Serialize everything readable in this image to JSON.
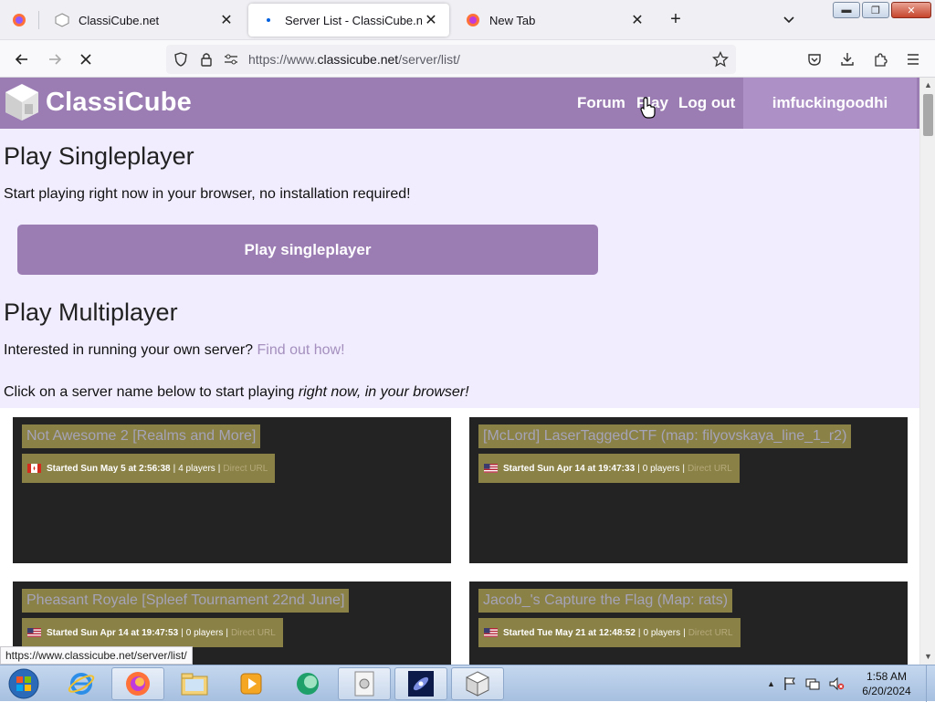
{
  "browser": {
    "tabs": [
      {
        "label": "ClassiCube.net",
        "active": false
      },
      {
        "label": "Server List - ClassiCube.net",
        "active": true
      },
      {
        "label": "New Tab",
        "active": false
      }
    ],
    "url_prefix": "https://www.",
    "url_domain": "classicube.net",
    "url_path": "/server/list/",
    "status_url": "https://www.classicube.net/server/list/"
  },
  "site": {
    "logo": "ClassiCube",
    "nav": {
      "forum": "Forum",
      "play": "Play",
      "logout": "Log out"
    },
    "username": "imfuckingoodhi"
  },
  "singleplayer": {
    "heading": "Play Singleplayer",
    "description": "Start playing right now in your browser, no installation required!",
    "button": "Play singleplayer"
  },
  "multiplayer": {
    "heading": "Play Multiplayer",
    "own_server_text": "Interested in running your own server?",
    "own_server_link": "Find out how!",
    "instruction_prefix": "Click on a server name below to start playing ",
    "instruction_emphasis": "right now, in your browser!"
  },
  "servers": [
    {
      "name": "Not Awesome 2 [Realms and More]",
      "flag": "ca",
      "started": "Started Sun May 5 at 2:56:38",
      "players": "4 players",
      "direct": "Direct URL"
    },
    {
      "name": "[McLord] LaserTaggedCTF (map: filyovskaya_line_1_r2)",
      "flag": "us",
      "started": "Started Sun Apr 14 at 19:47:33",
      "players": "0 players",
      "direct": "Direct URL"
    },
    {
      "name": "Pheasant Royale [Spleef Tournament 22nd June]",
      "flag": "us",
      "started": "Started Sun Apr 14 at 19:47:53",
      "players": "0 players",
      "direct": "Direct URL"
    },
    {
      "name": "Jacob_'s Capture the Flag (Map: rats)",
      "flag": "us",
      "started": "Started Tue May 21 at 12:48:52",
      "players": "0 players",
      "direct": "Direct URL"
    }
  ],
  "taskbar": {
    "clock_time": "1:58 AM",
    "clock_date": "6/20/2024"
  },
  "colors": {
    "header": "#9b7db3",
    "page_bg": "#f1edff",
    "server_card": "#232323",
    "server_highlight": "#8a8146"
  }
}
